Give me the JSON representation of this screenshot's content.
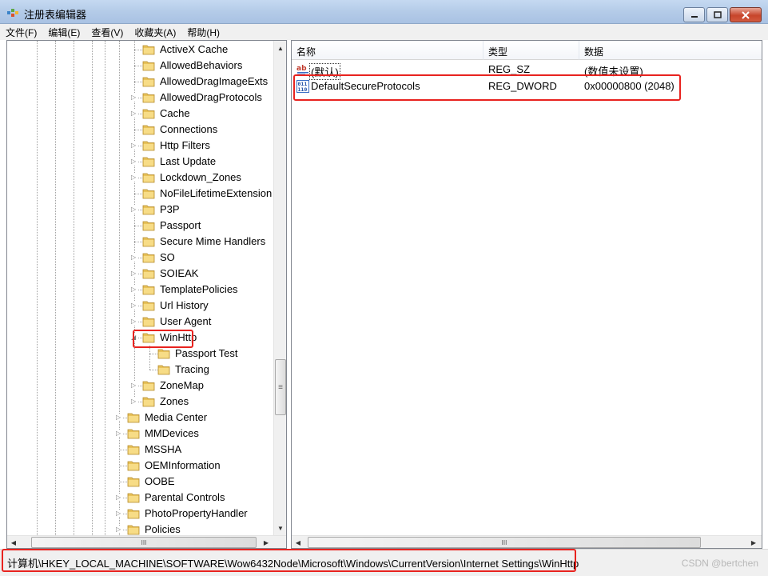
{
  "window": {
    "title": "注册表编辑器"
  },
  "menu": [
    "文件(F)",
    "编辑(E)",
    "查看(V)",
    "收藏夹(A)",
    "帮助(H)"
  ],
  "tree": [
    {
      "label": "ActiveX Cache",
      "expandable": false
    },
    {
      "label": "AllowedBehaviors",
      "expandable": false
    },
    {
      "label": "AllowedDragImageExts",
      "expandable": false
    },
    {
      "label": "AllowedDragProtocols",
      "expandable": true
    },
    {
      "label": "Cache",
      "expandable": true
    },
    {
      "label": "Connections",
      "expandable": false
    },
    {
      "label": "Http Filters",
      "expandable": true
    },
    {
      "label": "Last Update",
      "expandable": true
    },
    {
      "label": "Lockdown_Zones",
      "expandable": true
    },
    {
      "label": "NoFileLifetimeExtension",
      "expandable": false
    },
    {
      "label": "P3P",
      "expandable": true
    },
    {
      "label": "Passport",
      "expandable": false
    },
    {
      "label": "Secure Mime Handlers",
      "expandable": false
    },
    {
      "label": "SO",
      "expandable": true
    },
    {
      "label": "SOIEAK",
      "expandable": true
    },
    {
      "label": "TemplatePolicies",
      "expandable": true
    },
    {
      "label": "Url History",
      "expandable": true
    },
    {
      "label": "User Agent",
      "expandable": true
    },
    {
      "label": "WinHttp",
      "expandable": true,
      "expanded": true,
      "selected": true
    },
    {
      "label": "Passport Test",
      "expandable": false
    },
    {
      "label": "Tracing",
      "expandable": false
    },
    {
      "label": "ZoneMap",
      "expandable": true
    },
    {
      "label": "Zones",
      "expandable": true
    },
    {
      "label": "Media Center",
      "expandable": true
    },
    {
      "label": "MMDevices",
      "expandable": true
    },
    {
      "label": "MSSHA",
      "expandable": false
    },
    {
      "label": "OEMInformation",
      "expandable": false
    },
    {
      "label": "OOBE",
      "expandable": false
    },
    {
      "label": "Parental Controls",
      "expandable": true
    },
    {
      "label": "PhotoPropertyHandler",
      "expandable": true
    },
    {
      "label": "Policies",
      "expandable": true
    }
  ],
  "columns": {
    "name": "名称",
    "type": "类型",
    "data": "数据"
  },
  "values": [
    {
      "name": "(默认)",
      "type": "REG_SZ",
      "data": "(数值未设置)",
      "icon": "string-value-icon"
    },
    {
      "name": "DefaultSecureProtocols",
      "type": "REG_DWORD",
      "data": "0x00000800 (2048)",
      "icon": "binary-value-icon"
    }
  ],
  "scroll": {
    "hscroll_glyph": "III",
    "vscroll_glyph": "≡"
  },
  "statusbar": {
    "path": "计算机\\HKEY_LOCAL_MACHINE\\SOFTWARE\\Wow6432Node\\Microsoft\\Windows\\CurrentVersion\\Internet Settings\\WinHttp",
    "watermark": "CSDN @bertchen"
  },
  "colors": {
    "highlight": "#e8231f",
    "folder": "#e8c25a",
    "titlebar": "#b9cfeb"
  }
}
